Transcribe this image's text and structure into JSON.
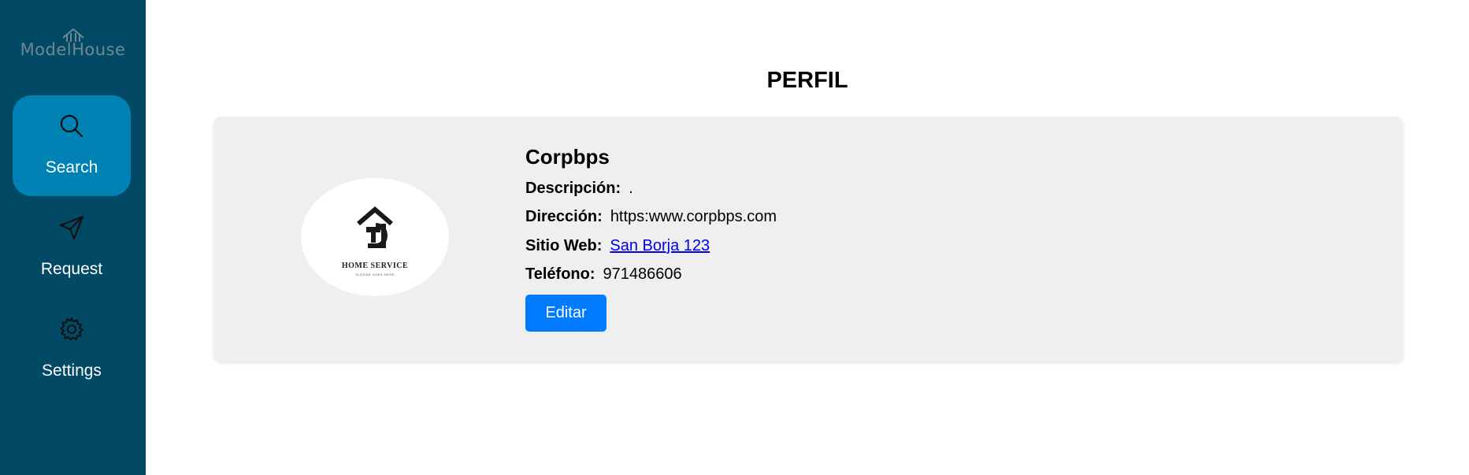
{
  "app": {
    "logo_text": "ModelHouse"
  },
  "sidebar": {
    "items": [
      {
        "label": "Search",
        "icon": "search-icon",
        "active": true
      },
      {
        "label": "Request",
        "icon": "send-icon",
        "active": false
      },
      {
        "label": "Settings",
        "icon": "gear-icon",
        "active": false
      }
    ]
  },
  "page": {
    "title": "PERFIL"
  },
  "profile": {
    "logo_brand": "HOME SERVICE",
    "logo_slogan": "SLOGAN GOES HERE",
    "name": "Corpbps",
    "descripcion_label": "Descripción:",
    "descripcion_value": ".",
    "direccion_label": "Dirección:",
    "direccion_value": "https:www.corpbps.com",
    "sitio_label": "Sitio Web:",
    "sitio_value": "San Borja 123",
    "telefono_label": "Teléfono:",
    "telefono_value": "971486606",
    "edit_label": "Editar"
  },
  "colors": {
    "sidebar_bg": "#024966",
    "active_item_bg": "#0082b5",
    "card_bg": "#efefef",
    "button_bg": "#007bff",
    "link": "#0000ee"
  }
}
